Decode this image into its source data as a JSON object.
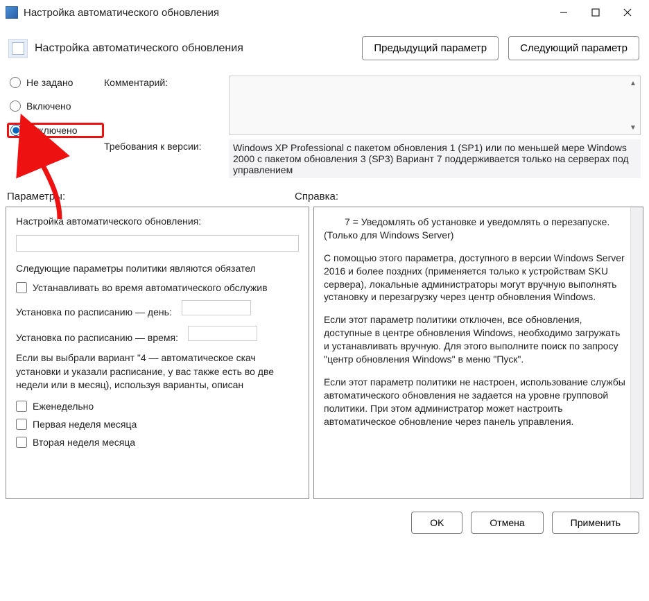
{
  "titlebar": {
    "title": "Настройка автоматического обновления"
  },
  "header": {
    "title": "Настройка автоматического обновления",
    "prev": "Предыдущий параметр",
    "next": "Следующий параметр"
  },
  "state": {
    "comment_label": "Комментарий:",
    "version_label": "Требования к версии:",
    "version_text": "Windows XP Professional с пакетом обновления 1 (SP1) или по меньшей мере Windows 2000 с пакетом обновления 3 (SP3)\nВариант 7 поддерживается только на серверах под управлением",
    "radios": {
      "not_configured": "Не задано",
      "enabled": "Включено",
      "disabled": "Отключено",
      "selected": "disabled"
    }
  },
  "sections": {
    "options": "Параметры:",
    "help": "Справка:"
  },
  "options": {
    "config_label": "Настройка автоматического обновления:",
    "config_value": "",
    "policy_note": "Следующие параметры политики являются обязател",
    "during_maintenance": "Устанавливать во время автоматического обслужив",
    "schedule_day_label": "Установка по расписанию — день:",
    "schedule_day_value": "",
    "schedule_time_label": "Установка по расписанию — время:",
    "schedule_time_value": "",
    "variant4_note": "Если вы выбрали вариант \"4 — автоматическое скач установки и указали расписание, у вас также есть во две недели или в месяц), используя варианты, описан",
    "weekly": "Еженедельно",
    "first_week": "Первая неделя месяца",
    "second_week": "Вторая неделя месяца"
  },
  "help": {
    "p1": "7 = Уведомлять об установке и уведомлять о перезапуске. (Только для Windows Server)",
    "p2": "С помощью этого параметра, доступного в версии Windows Server 2016 и более поздних (применяется только к устройствам SKU сервера), локальные администраторы могут вручную выполнять установку и перезагрузку через центр обновления Windows.",
    "p3": "Если этот параметр политики отключен, все обновления, доступные в центре обновления Windows, необходимо загружать и устанавливать вручную. Для этого выполните поиск по запросу \"центр обновления Windows\" в меню \"Пуск\".",
    "p4": "Если этот параметр политики не настроен, использование службы автоматического обновления не задается на уровне групповой политики. При этом администратор может настроить автоматическое обновление через панель управления."
  },
  "footer": {
    "ok": "OK",
    "cancel": "Отмена",
    "apply": "Применить"
  }
}
